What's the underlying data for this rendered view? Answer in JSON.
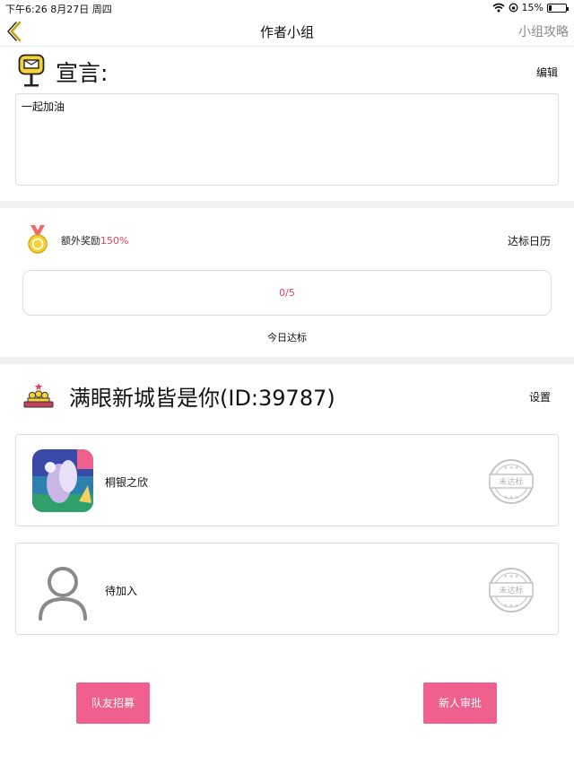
{
  "status_bar": {
    "time_date": "下午6:26   8月27日 周四",
    "battery": "15%",
    "battery_level": 0.15
  },
  "nav": {
    "title": "作者小组",
    "right_link": "小组攻略"
  },
  "manifesto": {
    "title": "宣言:",
    "edit_label": "编辑",
    "content": "一起加油"
  },
  "reward": {
    "label": "额外奖励",
    "percent": "150%",
    "calendar_label": "达标日历",
    "progress": "0/5",
    "today_label": "今日达标"
  },
  "group": {
    "name": "满眼新城皆是你(ID:39787)",
    "settings_label": "设置",
    "members": [
      {
        "name": "桐银之欣",
        "status": "未达标"
      },
      {
        "name": "待加入",
        "status": "未达标"
      }
    ]
  },
  "buttons": {
    "recruit": "队友招募",
    "approve": "新人审批"
  },
  "colors": {
    "accent_pink": "#f0608c",
    "highlight_red": "#e2445c",
    "icon_yellow": "#f5d23a"
  }
}
